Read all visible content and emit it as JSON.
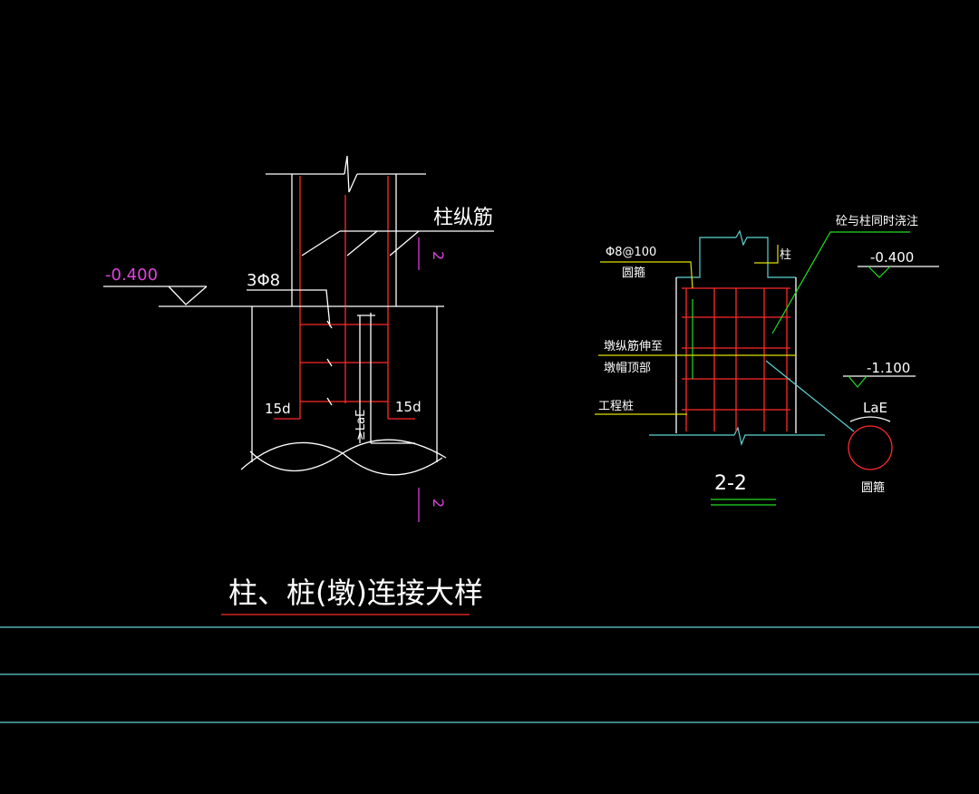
{
  "colors": {
    "background": "#000000",
    "white": "#ffffff",
    "red": "#ff2a2a",
    "cyan": "#5fd3d3",
    "green": "#22dd22",
    "yellow": "#e0e000",
    "magenta": "#cc33cc"
  },
  "left_detail": {
    "longitudinal_rebar": "柱纵筋",
    "elevation": "-0.400",
    "stirrup": "3Φ8",
    "hook_left": "15d",
    "hook_right": "15d",
    "anchor": "≥LaE",
    "section_mark_top": "2",
    "section_mark_bottom": "2",
    "title": "柱、桩(墩)连接大样"
  },
  "right_detail": {
    "stirrup_spec": "Φ8@100",
    "stirrup_type": "圆箍",
    "column": "柱",
    "concrete_note": "砼与柱同时浇注",
    "elevation_top": "-0.400",
    "pier_rebar_line1": "墩纵筋伸至",
    "pier_rebar_line2": "墩帽顶部",
    "pile_note": "工程桩",
    "elevation_bottom": "-1.100",
    "anchor": "LaE",
    "ring_label": "圆箍",
    "section_label": "2-2"
  }
}
